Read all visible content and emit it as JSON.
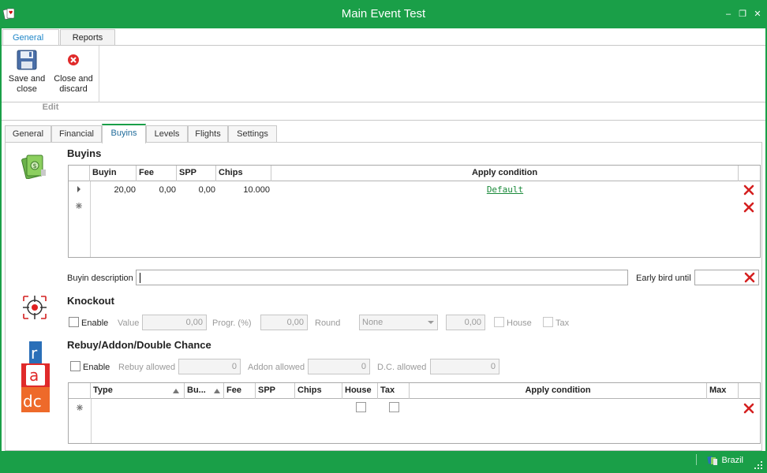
{
  "window": {
    "title": "Main Event Test",
    "minimize_glyph": "‒",
    "restore_glyph": "❐",
    "close_glyph": "✕"
  },
  "ribbon": {
    "tabs": [
      "General",
      "Reports"
    ],
    "active_tab": "General",
    "buttons": {
      "save_close": "Save and\nclose",
      "close_discard": "Close and\ndiscard"
    },
    "group_label": "Edit"
  },
  "tabs": [
    "General",
    "Financial",
    "Buyins",
    "Levels",
    "Flights",
    "Settings"
  ],
  "active_tab": "Buyins",
  "buyins": {
    "title": "Buyins",
    "columns": [
      "Buyin",
      "Fee",
      "SPP",
      "Chips",
      "Apply condition"
    ],
    "rows": [
      {
        "buyin": "20,00",
        "fee": "0,00",
        "spp": "0,00",
        "chips": "10.000",
        "condition": "Default"
      }
    ],
    "description_label": "Buyin description",
    "description_value": "",
    "early_bird_label": "Early bird until",
    "early_bird_value": ""
  },
  "knockout": {
    "title": "Knockout",
    "enable_label": "Enable",
    "value_label": "Value",
    "value": "0,00",
    "progr_label": "Progr. (%)",
    "progr_value": "0,00",
    "round_label": "Round",
    "round_selected": "None",
    "round_value": "0,00",
    "house_label": "House",
    "tax_label": "Tax"
  },
  "rebuy": {
    "title": "Rebuy/Addon/Double Chance",
    "enable_label": "Enable",
    "rebuy_allowed_label": "Rebuy allowed",
    "rebuy_allowed_value": "0",
    "addon_allowed_label": "Addon allowed",
    "addon_allowed_value": "0",
    "dc_allowed_label": "D.C. allowed",
    "dc_allowed_value": "0",
    "columns": [
      "Type",
      "Bu...",
      "Fee",
      "SPP",
      "Chips",
      "House",
      "Tax",
      "Apply condition",
      "Max"
    ]
  },
  "status": {
    "region": "Brazil"
  },
  "colors": {
    "accent_green": "#1a9f48",
    "delete_red": "#d42020",
    "tab_blue": "#1e86c8",
    "link_green": "#1a8a3a"
  },
  "icons": {
    "app": "cards-icon",
    "save": "floppy-disk-icon",
    "discard": "red-x-circle-icon",
    "buyins": "money-icon",
    "knockout": "target-icon",
    "rebuy": "rad-letters-icon",
    "delete": "red-x-icon",
    "region": "region-icon",
    "new_row": "asterisk-icon",
    "row_pointer": "triangle-right-icon"
  }
}
